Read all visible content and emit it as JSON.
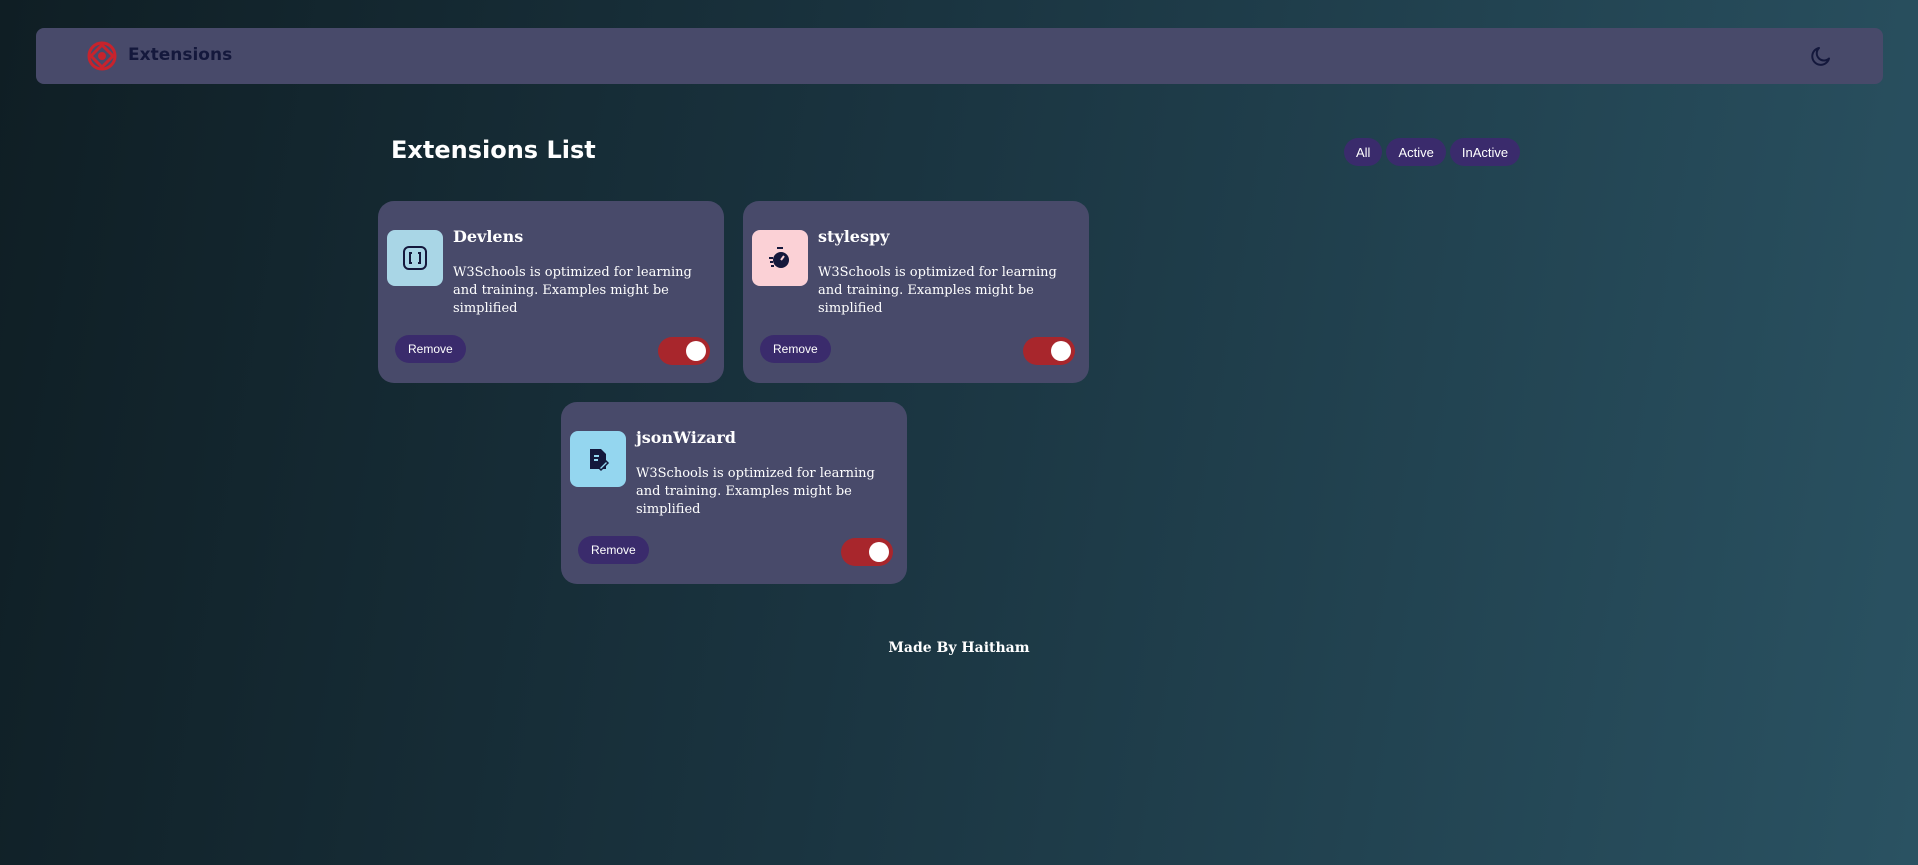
{
  "header": {
    "brand": "Extensions",
    "logo_icon": "extensions-logo-icon",
    "theme_icon": "moon-icon"
  },
  "main": {
    "title": "Extensions List",
    "filters": [
      {
        "label": "All"
      },
      {
        "label": "Active"
      },
      {
        "label": "InActive"
      }
    ]
  },
  "extensions": [
    {
      "name": "Devlens",
      "description": "W3Schools is optimized for learning and training. Examples might be simplified",
      "icon": "brackets-icon",
      "icon_bg": "#a9d6e6",
      "remove_label": "Remove",
      "active": true
    },
    {
      "name": "stylespy",
      "description": "W3Schools is optimized for learning and training. Examples might be simplified",
      "icon": "stopwatch-icon",
      "icon_bg": "#fbd1d6",
      "remove_label": "Remove",
      "active": true
    },
    {
      "name": "jsonWizard",
      "description": "W3Schools is optimized for learning and training. Examples might be simplified",
      "icon": "document-edit-icon",
      "icon_bg": "#94d6ef",
      "remove_label": "Remove",
      "active": true
    }
  ],
  "footer": {
    "text": "Made By Haitham"
  },
  "colors": {
    "surface": "#484a6a",
    "button": "#3a2b6c",
    "toggle_on": "#a8262c",
    "logo": "#c8232c",
    "brand_text": "#14183c"
  }
}
